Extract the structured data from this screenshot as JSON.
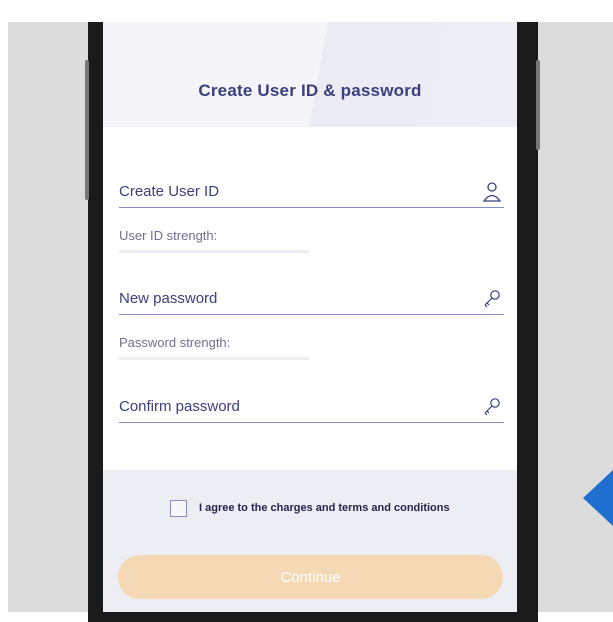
{
  "page": {
    "title": "Create User ID & password"
  },
  "form": {
    "user_id": {
      "placeholder": "Create User ID",
      "icon": "user-icon"
    },
    "user_id_strength_label": "User ID strength:",
    "new_password": {
      "placeholder": "New password",
      "icon": "key-icon"
    },
    "password_strength_label": "Password strength:",
    "confirm_password": {
      "placeholder": "Confirm password",
      "icon": "key-icon"
    }
  },
  "terms": {
    "checked": false,
    "label": "I agree to the charges and terms and conditions"
  },
  "actions": {
    "continue_label": "Continue",
    "continue_enabled": false
  },
  "colors": {
    "accent": "#3c3f7e",
    "button_disabled": "#f5d8b4",
    "field_line": "#8a8cc6",
    "decor_arrow": "#1f6fd1"
  }
}
